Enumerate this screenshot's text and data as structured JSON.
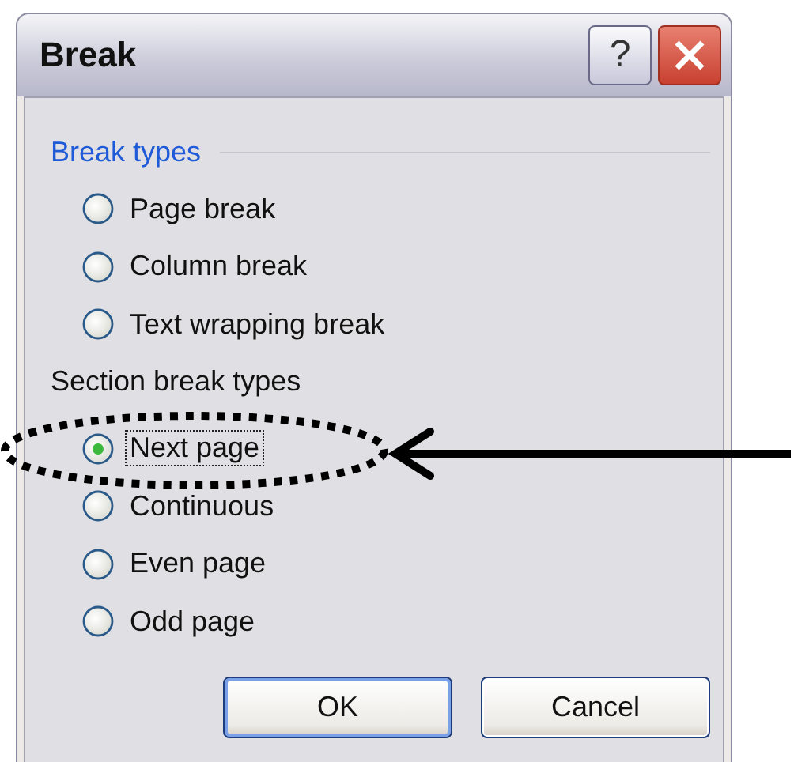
{
  "window": {
    "title": "Break",
    "help_label": "?"
  },
  "groups": [
    {
      "title": "Break types",
      "kind": "fieldset",
      "options": [
        {
          "label": "Page break",
          "selected": false,
          "focused": false
        },
        {
          "label": "Column break",
          "selected": false,
          "focused": false
        },
        {
          "label": "Text wrapping break",
          "selected": false,
          "focused": false
        }
      ]
    },
    {
      "title": "Section break types",
      "kind": "plain",
      "options": [
        {
          "label": "Next page",
          "selected": true,
          "focused": true
        },
        {
          "label": "Continuous",
          "selected": false,
          "focused": false
        },
        {
          "label": "Even page",
          "selected": false,
          "focused": false
        },
        {
          "label": "Odd page",
          "selected": false,
          "focused": false
        }
      ]
    }
  ],
  "buttons": [
    {
      "label": "OK",
      "default": true
    },
    {
      "label": "Cancel",
      "default": false
    }
  ],
  "annotation": {
    "kind": "circled-with-arrow"
  }
}
